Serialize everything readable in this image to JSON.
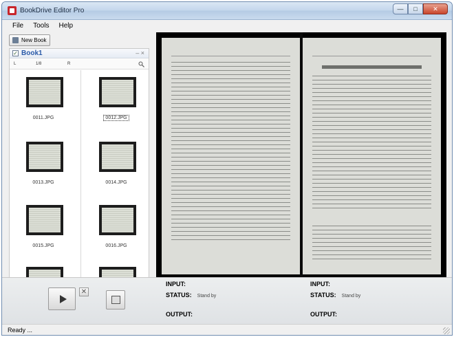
{
  "window": {
    "title": "BookDrive Editor Pro",
    "buttons": {
      "minimize": "—",
      "maximize": "□",
      "close": "✕"
    }
  },
  "menu": [
    "File",
    "Tools",
    "Help"
  ],
  "toolbar": {
    "new_book_label": "New Book"
  },
  "book": {
    "title": "Book1",
    "checked": true,
    "nav": {
      "left": "L",
      "center": "1/8",
      "right": "R"
    },
    "thumbnails": [
      {
        "label": "0011.JPG",
        "selected": false
      },
      {
        "label": "0012.JPG",
        "selected": true
      },
      {
        "label": "0013.JPG",
        "selected": false
      },
      {
        "label": "0014.JPG",
        "selected": false
      },
      {
        "label": "0015.JPG",
        "selected": false
      },
      {
        "label": "0016.JPG",
        "selected": false
      }
    ]
  },
  "controls": {
    "play_icon": "play-icon",
    "stop_glyph": "✕",
    "scan_icon": "scanner-icon"
  },
  "left_status": {
    "input_label": "INPUT:",
    "status_label": "STATUS:",
    "status_value": "Stand by",
    "output_label": "OUTPUT:"
  },
  "right_status": {
    "input_label": "INPUT:",
    "status_label": "STATUS:",
    "status_value": "Stand by",
    "output_label": "OUTPUT:"
  },
  "statusbar": {
    "text": "Ready ..."
  }
}
